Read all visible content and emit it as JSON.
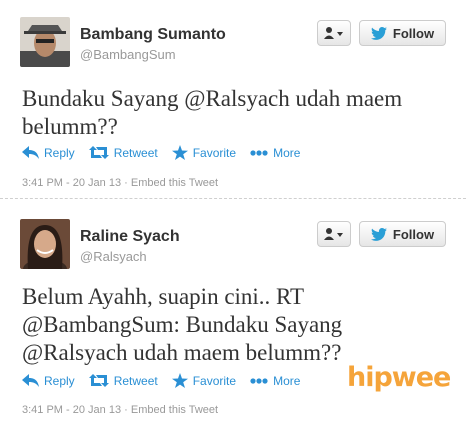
{
  "tweets": [
    {
      "name": "Bambang Sumanto",
      "handle": "@BambangSum",
      "follow_label": "Follow",
      "text_lines": [
        "Bundaku Sayang @Ralsyach udah maem",
        "belumm??"
      ],
      "actions": {
        "reply": "Reply",
        "retweet": "Retweet",
        "favorite": "Favorite",
        "more": "More"
      },
      "timestamp": "3:41 PM - 20 Jan 13",
      "embed": "Embed this Tweet"
    },
    {
      "name": "Raline Syach",
      "handle": "@Ralsyach",
      "follow_label": "Follow",
      "text_lines": [
        "Belum Ayahh, suapin cini.. RT",
        "@BambangSum: Bundaku Sayang",
        "@Ralsyach udah maem belumm??"
      ],
      "actions": {
        "reply": "Reply",
        "retweet": "Retweet",
        "favorite": "Favorite",
        "more": "More"
      },
      "timestamp": "3:41 PM - 20 Jan 13",
      "embed": "Embed this Tweet"
    }
  ],
  "watermark": "hipwee",
  "colors": {
    "link": "#2a8fd4",
    "twitter_bird": "#2a9fd6",
    "watermark": "#f5a43a"
  }
}
